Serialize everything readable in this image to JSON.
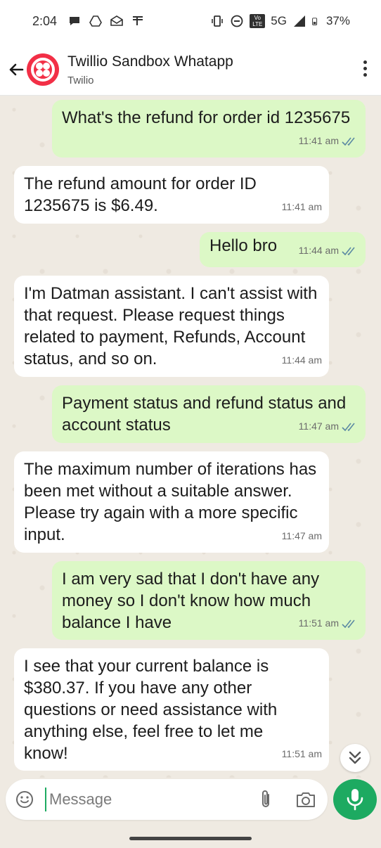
{
  "status_bar": {
    "time": "2:04",
    "network": "5G",
    "battery": "37%",
    "volte": "Vo LTE"
  },
  "header": {
    "title": "Twillio Sandbox Whatapp",
    "subtitle": "Twilio"
  },
  "messages": [
    {
      "direction": "out",
      "text": "What's the refund for order id 1235675",
      "time": "11:41 am",
      "read": true
    },
    {
      "direction": "in",
      "text": "The refund amount for order ID 1235675 is $6.49.",
      "time": "11:41 am"
    },
    {
      "direction": "out",
      "text": "Hello bro",
      "time": "11:44 am",
      "read": true
    },
    {
      "direction": "in",
      "text": "I'm Datman assistant. I can't assist with that request. Please request things related to payment, Refunds, Account status, and so on.",
      "time": "11:44 am"
    },
    {
      "direction": "out",
      "text": "Payment status and refund status and account status",
      "time": "11:47 am",
      "read": true
    },
    {
      "direction": "in",
      "text": "The maximum number of iterations has been met without a suitable answer. Please try again with a more specific input.",
      "time": "11:47 am"
    },
    {
      "direction": "out",
      "text": "I am very sad that I don't have any money so I don't know how much balance I have",
      "time": "11:51 am",
      "read": true
    },
    {
      "direction": "in",
      "text": "I see that your current balance is $380.37. If you have any other questions or need assistance with anything else, feel free to let me know!",
      "time": "11:51 am"
    }
  ],
  "composer": {
    "placeholder": "Message",
    "value": ""
  },
  "colors": {
    "outgoing_bubble": "#dcf8c6",
    "incoming_bubble": "#ffffff",
    "accent": "#1daa61",
    "avatar": "#f22f46",
    "read_tick": "#53bdeb"
  }
}
